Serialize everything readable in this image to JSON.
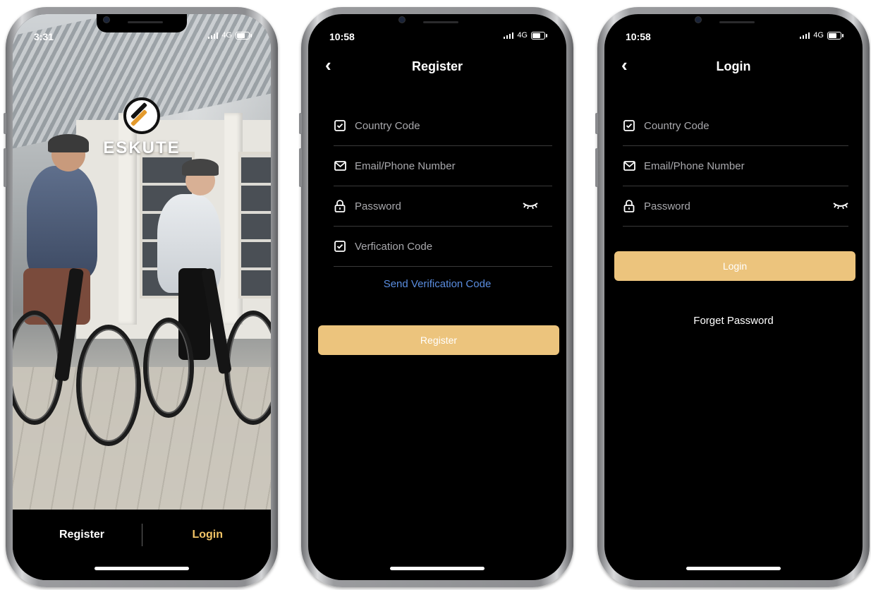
{
  "welcome": {
    "status_time": "3:31",
    "status_network": "4G",
    "brand": "ESKUTE",
    "register_tab": "Register",
    "login_tab": "Login"
  },
  "register": {
    "status_time": "10:58",
    "status_network": "4G",
    "title": "Register",
    "country_code_placeholder": "Country Code",
    "email_phone_placeholder": "Email/Phone Number",
    "password_placeholder": "Password",
    "verification_code_placeholder": "Verfication Code",
    "send_code_label": "Send Verification Code",
    "submit_label": "Register"
  },
  "login": {
    "status_time": "10:58",
    "status_network": "4G",
    "title": "Login",
    "country_code_placeholder": "Country Code",
    "email_phone_placeholder": "Email/Phone Number",
    "password_placeholder": "Password",
    "submit_label": "Login",
    "forget_label": "Forget Password"
  },
  "colors": {
    "accent_gold": "#ecc47d",
    "login_tab_gold": "#f2c466",
    "link_blue": "#5a8de0",
    "background": "#000000"
  },
  "icons": [
    "checkbox-icon",
    "mail-icon",
    "lock-icon",
    "eye-closed-icon",
    "chevron-left-icon",
    "signal-icon",
    "battery-icon"
  ]
}
